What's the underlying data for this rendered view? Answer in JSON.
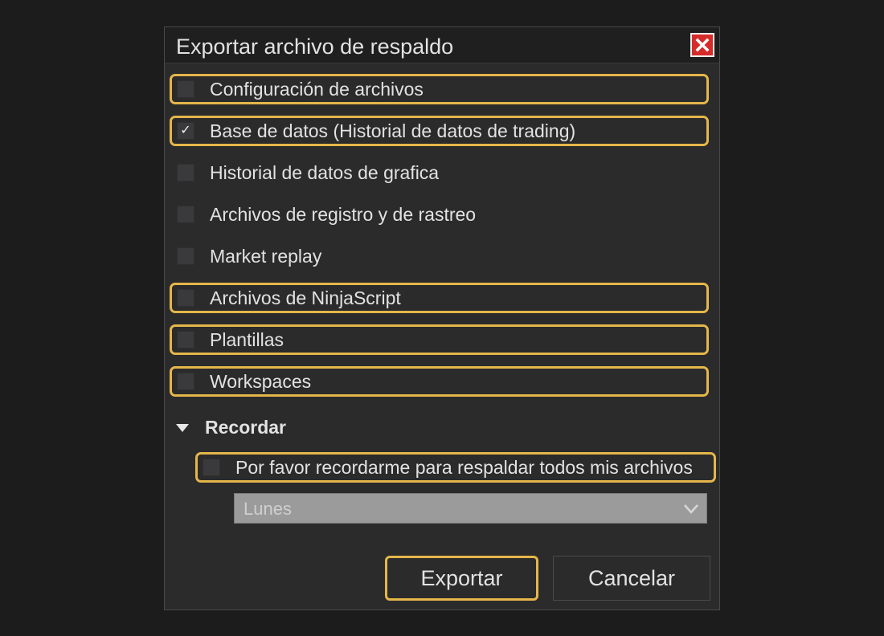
{
  "dialog": {
    "title": "Exportar archivo de respaldo",
    "close_icon": "close-icon"
  },
  "options": [
    {
      "label": "Configuración de archivos",
      "checked": false,
      "highlighted": true
    },
    {
      "label": "Base de datos (Historial de datos de trading)",
      "checked": true,
      "highlighted": true
    },
    {
      "label": "Historial de datos de grafica",
      "checked": false,
      "highlighted": false
    },
    {
      "label": "Archivos de registro y de rastreo",
      "checked": false,
      "highlighted": false
    },
    {
      "label": "Market replay",
      "checked": false,
      "highlighted": false
    },
    {
      "label": "Archivos de NinjaScript",
      "checked": false,
      "highlighted": true
    },
    {
      "label": "Plantillas",
      "checked": false,
      "highlighted": true
    },
    {
      "label": "Workspaces",
      "checked": false,
      "highlighted": true
    }
  ],
  "remember": {
    "section_label": "Recordar",
    "checkbox_label": "Por favor recordarme para respaldar todos mis archivos",
    "checked": false,
    "day_select_value": "Lunes"
  },
  "buttons": {
    "export_label": "Exportar",
    "cancel_label": "Cancelar"
  },
  "colors": {
    "highlight": "#e5b64a",
    "close_button": "#d62b2b"
  },
  "icons": {
    "check": "✓",
    "collapse": "triangle-down-icon",
    "dropdown": "chevron-down-icon"
  }
}
